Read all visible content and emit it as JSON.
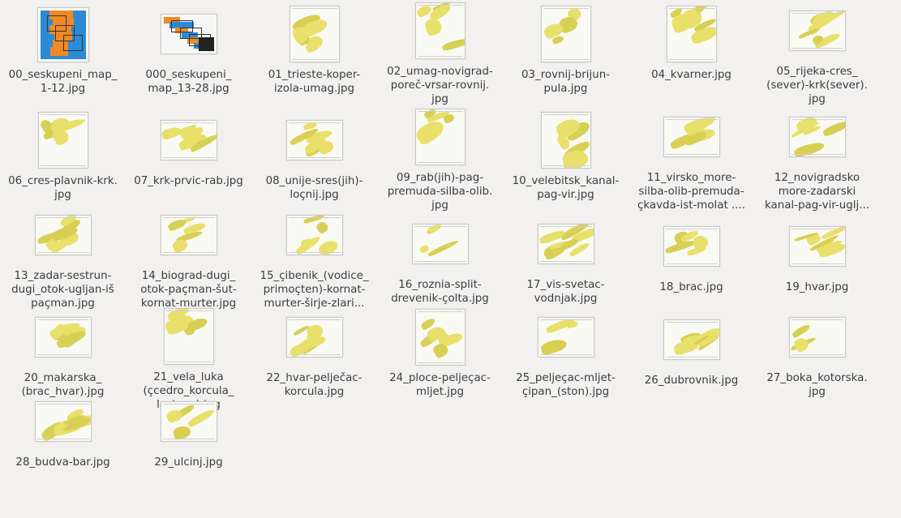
{
  "files": [
    {
      "label": "00_seskupeni_map_\n1-12.jpg",
      "thumb": "overview",
      "thumb_icon": "map-overview-thumbnail"
    },
    {
      "label": "000_seskupeni_\nmap_13-28.jpg",
      "thumb": "overview2",
      "thumb_icon": "map-overview-thumbnail"
    },
    {
      "label": "01_trieste-koper-\nizola-umag.jpg",
      "thumb": "portrait",
      "thumb_icon": "nautical-chart-thumbnail"
    },
    {
      "label": "02_umag-novigrad-\nporeč-vrsar-rovnij.\njpg",
      "thumb": "portrait",
      "thumb_icon": "nautical-chart-thumbnail"
    },
    {
      "label": "03_rovnij-brijun-\npula.jpg",
      "thumb": "portrait",
      "thumb_icon": "nautical-chart-thumbnail"
    },
    {
      "label": "04_kvarner.jpg",
      "thumb": "portrait",
      "thumb_icon": "nautical-chart-thumbnail"
    },
    {
      "label": "05_rijeka-cres_\n(sever)-krk(sever).\njpg",
      "thumb": "landscape",
      "thumb_icon": "nautical-chart-thumbnail"
    },
    {
      "label": "06_cres-plavnik-krk.\njpg",
      "thumb": "portrait",
      "thumb_icon": "nautical-chart-thumbnail"
    },
    {
      "label": "07_krk-prvic-rab.jpg",
      "thumb": "landscape",
      "thumb_icon": "nautical-chart-thumbnail"
    },
    {
      "label": "08_unije-sres(jih)-\nloçnij.jpg",
      "thumb": "landscape",
      "thumb_icon": "nautical-chart-thumbnail"
    },
    {
      "label": "09_rab(jih)-pag-\npremuda-silba-olib.\njpg",
      "thumb": "portrait",
      "thumb_icon": "nautical-chart-thumbnail"
    },
    {
      "label": "10_velebitsk_kanal-\npag-vir.jpg",
      "thumb": "portrait",
      "thumb_icon": "nautical-chart-thumbnail"
    },
    {
      "label": "11_virsko_more-\nsilba-olib-premuda-\nçkavda-ist-molat ....",
      "thumb": "landscape",
      "thumb_icon": "nautical-chart-thumbnail"
    },
    {
      "label": "12_novigradsko\nmore-zadarski\nkanal-pag-vir-uglj...",
      "thumb": "landscape",
      "thumb_icon": "nautical-chart-thumbnail"
    },
    {
      "label": "13_zadar-sestrun-\ndugi_otok-ugljan-iš\npaçman.jpg",
      "thumb": "landscape",
      "thumb_icon": "nautical-chart-thumbnail"
    },
    {
      "label": "14_biograd-dugi_\notok-paçman-šut-\nkornat-murter.jpg",
      "thumb": "landscape",
      "thumb_icon": "nautical-chart-thumbnail"
    },
    {
      "label": "15_çibenik_(vodice_\nprimoçten)-kornat-\nmurter-širje-zlari...",
      "thumb": "landscape",
      "thumb_icon": "nautical-chart-thumbnail"
    },
    {
      "label": "16_roznia-split-\ndrevenik-çolta.jpg",
      "thumb": "landscape",
      "thumb_icon": "nautical-chart-thumbnail"
    },
    {
      "label": "17_vis-svetac-\nvodnjak.jpg",
      "thumb": "landscape",
      "thumb_icon": "nautical-chart-thumbnail"
    },
    {
      "label": "18_brac.jpg",
      "thumb": "landscape",
      "thumb_icon": "nautical-chart-thumbnail"
    },
    {
      "label": "19_hvar.jpg",
      "thumb": "landscape",
      "thumb_icon": "nautical-chart-thumbnail"
    },
    {
      "label": "20_makarska_\n(brac_hvar).jpg",
      "thumb": "landscape",
      "thumb_icon": "nautical-chart-thumbnail"
    },
    {
      "label": "21_vela_luka\n(çcedro_korcula_\nlastovo).jpg",
      "thumb": "portrait",
      "thumb_icon": "nautical-chart-thumbnail"
    },
    {
      "label": "22_hvar-pelječac-\nkorcula.jpg",
      "thumb": "landscape",
      "thumb_icon": "nautical-chart-thumbnail"
    },
    {
      "label": "24_ploce-peljeçac-\nmljet.jpg",
      "thumb": "portrait",
      "thumb_icon": "nautical-chart-thumbnail"
    },
    {
      "label": "25_peljeçac-mljet-\nçipan_(ston).jpg",
      "thumb": "landscape",
      "thumb_icon": "nautical-chart-thumbnail"
    },
    {
      "label": "26_dubrovnik.jpg",
      "thumb": "landscape",
      "thumb_icon": "nautical-chart-thumbnail"
    },
    {
      "label": "27_boka_kotorska.\njpg",
      "thumb": "landscape",
      "thumb_icon": "nautical-chart-thumbnail"
    },
    {
      "label": "28_budva-bar.jpg",
      "thumb": "landscape",
      "thumb_icon": "nautical-chart-thumbnail"
    },
    {
      "label": "29_ulcinj.jpg",
      "thumb": "landscape",
      "thumb_icon": "nautical-chart-thumbnail"
    }
  ]
}
